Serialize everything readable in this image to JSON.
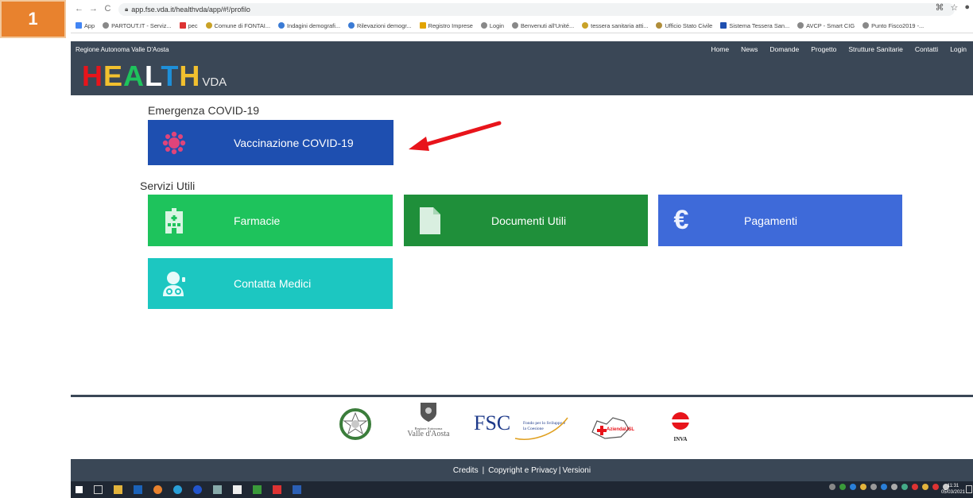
{
  "step": {
    "number": "1"
  },
  "browser": {
    "url": "app.fse.vda.it/healthvda/app/#!/profilo",
    "bookmarks": [
      "App",
      "PARTOUT.IT - Serviz...",
      "pec",
      "Comune di FONTAI...",
      "Indagini demografi...",
      "Rilevazioni demogr...",
      "Registro Imprese",
      "Login",
      "Benvenuti all'Unité...",
      "tessera sanitaria atti...",
      "Ufficio Stato Civile",
      "Sistema Tessera San...",
      "AVCP - Smart CIG",
      "Punto Fisco2019 -..."
    ]
  },
  "site": {
    "region": "Regione Autonoma Valle D'Aosta",
    "nav": [
      "Home",
      "News",
      "Domande",
      "Progetto",
      "Strutture Sanitarie",
      "Contatti",
      "Login"
    ],
    "logo_text": "HEALTH",
    "logo_suffix": "VDA"
  },
  "sections": {
    "covid_title": "Emergenza COVID-19",
    "utili_title": "Servizi Utili"
  },
  "tiles": {
    "vaccinazione": {
      "label": "Vaccinazione COVID-19",
      "color": "#1e4fb0",
      "icon": "virus-icon"
    },
    "farmacie": {
      "label": "Farmacie",
      "color": "#1ec35c",
      "icon": "pharmacy-building-icon"
    },
    "documenti": {
      "label": "Documenti Utili",
      "color": "#1f8f3a",
      "icon": "document-icon"
    },
    "pagamenti": {
      "label": "Pagamenti",
      "color": "#3e6ad9",
      "icon": "euro-icon"
    },
    "medici": {
      "label": "Contatta Medici",
      "color": "#1cc7c1",
      "icon": "doctor-icon"
    }
  },
  "footer": {
    "fsc_text": "FSC",
    "fsc_sub": "Fondo per lo Sviluppo e la Coesione",
    "valle_text": "Valle d'Aosta",
    "valle_sub": "Regione Autonoma",
    "usl_text": "AziendaUSL",
    "inva_text": "INVA",
    "credits": "Credits",
    "copyright": "Copyright e Privacy",
    "versioni": "Versioni",
    "separator": "|"
  },
  "taskbar": {
    "time": "11:31",
    "date": "05/03/2021"
  }
}
